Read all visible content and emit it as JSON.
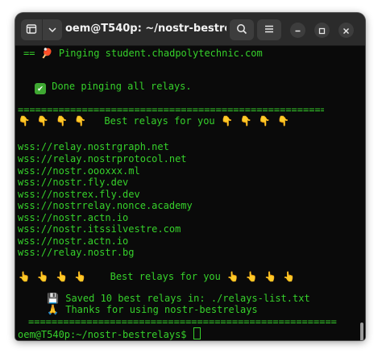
{
  "window": {
    "title": "oem@T540p: ~/nostr-bestrel..."
  },
  "icons": {
    "new_tab": "new-tab-icon",
    "tab_menu": "chevron-down-icon",
    "search": "search-icon",
    "menu": "hamburger-menu-icon",
    "minimize": "minimize-icon",
    "maximize": "maximize-icon",
    "close": "close-icon"
  },
  "terminal": {
    "pinging_line": "== 🏓 Pinging student.chadpolytechnic.com",
    "done_line": "Done pinging all relays.",
    "separator_top": "=====================================================",
    "best_header": "Best relays for you",
    "relays": [
      "wss://relay.nostrgraph.net",
      "wss://relay.nostrprotocol.net",
      "wss://nostr.oooxxx.ml",
      "wss://nostr.fly.dev",
      "wss://nostrex.fly.dev",
      "wss://nostrrelay.nonce.academy",
      "wss://nostr.actn.io",
      "wss://nostr.itssilvestre.com",
      "wss://nostr.actn.io",
      "wss://relay.nostr.bg"
    ],
    "best_footer": "Best relays for you",
    "saved_line": "Saved 10 best relays in: ./relays-list.txt",
    "thanks_line": "Thanks for using nostr-bestrelays",
    "separator_bottom": "=====================================================",
    "prompt": "oem@T540p:~/nostr-bestrelays$"
  },
  "colors": {
    "terminal_text": "#36d12b",
    "terminal_bg": "#0a0a0a",
    "titlebar_bg": "#2b2b2b"
  }
}
